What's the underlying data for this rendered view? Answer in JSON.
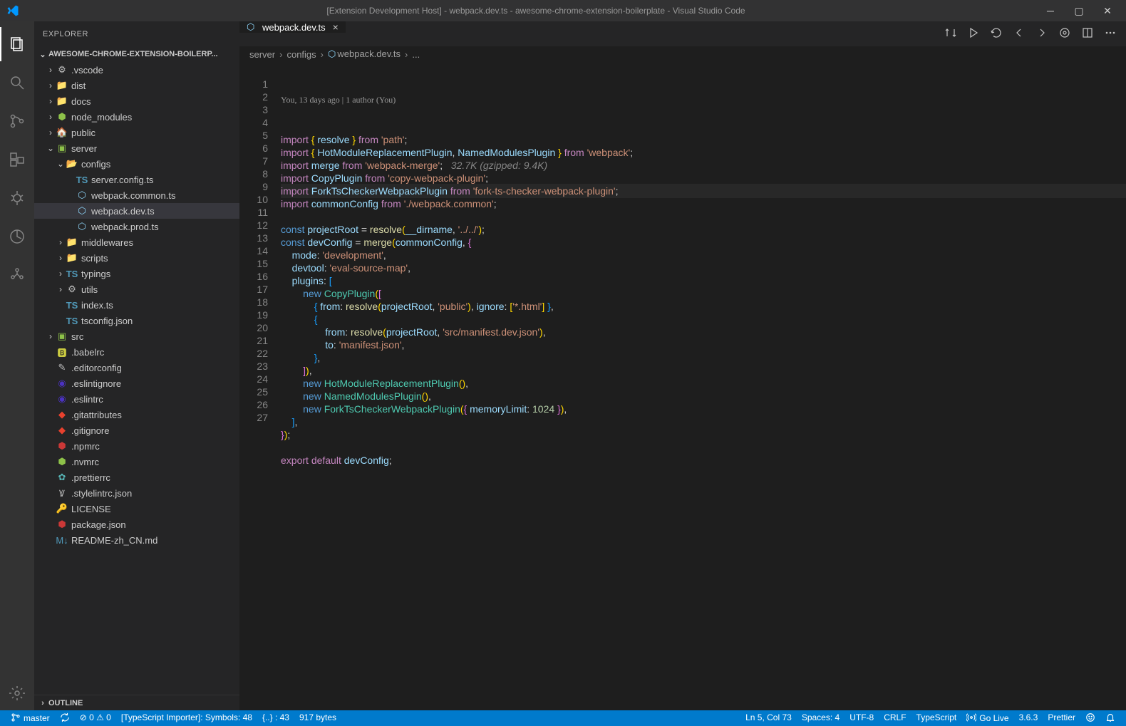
{
  "titlebar": {
    "title": "[Extension Development Host] - webpack.dev.ts - awesome-chrome-extension-boilerplate - Visual Studio Code"
  },
  "sidebar": {
    "panel_title": "EXPLORER",
    "workspace_header": "AWESOME-CHROME-EXTENSION-BOILERP...",
    "outline_header": "OUTLINE",
    "tree": [
      {
        "depth": 0,
        "kind": "folder",
        "expanded": false,
        "icon": "folder",
        "iconClass": "ic-gear",
        "glyph": "⚙",
        "label": ".vscode"
      },
      {
        "depth": 0,
        "kind": "folder",
        "expanded": false,
        "icon": "folder",
        "iconClass": "ic-folder",
        "glyph": "📁",
        "label": "dist"
      },
      {
        "depth": 0,
        "kind": "folder",
        "expanded": false,
        "icon": "folder",
        "iconClass": "ic-folder",
        "glyph": "📁",
        "label": "docs"
      },
      {
        "depth": 0,
        "kind": "folder",
        "expanded": false,
        "icon": "folder",
        "iconClass": "ic-node",
        "glyph": "⬢",
        "label": "node_modules"
      },
      {
        "depth": 0,
        "kind": "folder",
        "expanded": false,
        "icon": "folder",
        "iconClass": "ic-home",
        "glyph": "🏠",
        "label": "public"
      },
      {
        "depth": 0,
        "kind": "folder",
        "expanded": true,
        "icon": "folder",
        "iconClass": "ic-green",
        "glyph": "▣",
        "label": "server"
      },
      {
        "depth": 1,
        "kind": "folder",
        "expanded": true,
        "icon": "folder",
        "iconClass": "ic-folder",
        "glyph": "📂",
        "label": "configs"
      },
      {
        "depth": 2,
        "kind": "file",
        "icon": "ts",
        "iconClass": "ic-ts",
        "glyph": "TS",
        "label": "server.config.ts"
      },
      {
        "depth": 2,
        "kind": "file",
        "icon": "webpack",
        "iconClass": "ic-wp",
        "glyph": "⬡",
        "label": "webpack.common.ts"
      },
      {
        "depth": 2,
        "kind": "file",
        "icon": "webpack",
        "iconClass": "ic-wp",
        "glyph": "⬡",
        "label": "webpack.dev.ts",
        "selected": true
      },
      {
        "depth": 2,
        "kind": "file",
        "icon": "webpack",
        "iconClass": "ic-wp",
        "glyph": "⬡",
        "label": "webpack.prod.ts"
      },
      {
        "depth": 1,
        "kind": "folder",
        "expanded": false,
        "icon": "folder",
        "iconClass": "ic-folder",
        "glyph": "📁",
        "label": "middlewares"
      },
      {
        "depth": 1,
        "kind": "folder",
        "expanded": false,
        "icon": "folder",
        "iconClass": "ic-folder",
        "glyph": "📁",
        "label": "scripts"
      },
      {
        "depth": 1,
        "kind": "folder",
        "expanded": false,
        "icon": "folder",
        "iconClass": "ic-ts",
        "glyph": "TS",
        "label": "typings"
      },
      {
        "depth": 1,
        "kind": "folder",
        "expanded": false,
        "icon": "folder",
        "iconClass": "ic-gear",
        "glyph": "⚙",
        "label": "utils"
      },
      {
        "depth": 1,
        "kind": "file",
        "icon": "ts",
        "iconClass": "ic-ts",
        "glyph": "TS",
        "label": "index.ts"
      },
      {
        "depth": 1,
        "kind": "file",
        "icon": "ts",
        "iconClass": "ic-ts",
        "glyph": "TS",
        "label": "tsconfig.json"
      },
      {
        "depth": 0,
        "kind": "folder",
        "expanded": false,
        "icon": "folder",
        "iconClass": "ic-green",
        "glyph": "▣",
        "label": "src"
      },
      {
        "depth": 0,
        "kind": "file",
        "icon": "babel",
        "iconClass": "ic-js",
        "glyph": "🅱",
        "label": ".babelrc"
      },
      {
        "depth": 0,
        "kind": "file",
        "icon": "editorcfg",
        "iconClass": "ic-gear",
        "glyph": "✎",
        "label": ".editorconfig"
      },
      {
        "depth": 0,
        "kind": "file",
        "icon": "eslint",
        "iconClass": "ic-es",
        "glyph": "◉",
        "label": ".eslintignore"
      },
      {
        "depth": 0,
        "kind": "file",
        "icon": "eslint",
        "iconClass": "ic-es",
        "glyph": "◉",
        "label": ".eslintrc"
      },
      {
        "depth": 0,
        "kind": "file",
        "icon": "git",
        "iconClass": "ic-git",
        "glyph": "◆",
        "label": ".gitattributes"
      },
      {
        "depth": 0,
        "kind": "file",
        "icon": "git",
        "iconClass": "ic-git",
        "glyph": "◆",
        "label": ".gitignore"
      },
      {
        "depth": 0,
        "kind": "file",
        "icon": "npm",
        "iconClass": "ic-npm",
        "glyph": "⬢",
        "label": ".npmrc"
      },
      {
        "depth": 0,
        "kind": "file",
        "icon": "nvm",
        "iconClass": "ic-node",
        "glyph": "⬢",
        "label": ".nvmrc"
      },
      {
        "depth": 0,
        "kind": "file",
        "icon": "prettier",
        "iconClass": "ic-pret",
        "glyph": "✿",
        "label": ".prettierrc"
      },
      {
        "depth": 0,
        "kind": "file",
        "icon": "stylelint",
        "iconClass": "ic-gear",
        "glyph": "Ꝟ",
        "label": ".stylelintrc.json"
      },
      {
        "depth": 0,
        "kind": "file",
        "icon": "license",
        "iconClass": "ic-lic",
        "glyph": "🔑",
        "label": "LICENSE"
      },
      {
        "depth": 0,
        "kind": "file",
        "icon": "npm",
        "iconClass": "ic-npm",
        "glyph": "⬢",
        "label": "package.json"
      },
      {
        "depth": 0,
        "kind": "file",
        "icon": "md",
        "iconClass": "ic-md",
        "glyph": "M↓",
        "label": "README-zh_CN.md"
      }
    ]
  },
  "tabs": [
    {
      "icon": "⬡",
      "iconClass": "ic-wp",
      "label": "webpack.dev.ts",
      "active": true
    }
  ],
  "breadcrumbs": [
    {
      "label": "server"
    },
    {
      "label": "configs"
    },
    {
      "icon": "⬡",
      "label": "webpack.dev.ts"
    },
    {
      "label": "..."
    }
  ],
  "codelens": "You, 13 days ago | 1 author (You)",
  "code_lines": [
    "<span class='k-import'>import</span> <span class='k-brace'>{</span> <span class='k-var'>resolve</span> <span class='k-brace'>}</span> <span class='k-from'>from</span> <span class='k-str'>'path'</span>;",
    "<span class='k-import'>import</span> <span class='k-brace'>{</span> <span class='k-var'>HotModuleReplacementPlugin</span>, <span class='k-var'>NamedModulesPlugin</span> <span class='k-brace'>}</span> <span class='k-from'>from</span> <span class='k-str'>'webpack'</span>;",
    "<span class='k-import'>import</span> <span class='k-var'>merge</span> <span class='k-from'>from</span> <span class='k-str'>'webpack-merge'</span>;   <span class='k-hint'>32.7K (gzipped: 9.4K)</span>",
    "<span class='k-import'>import</span> <span class='k-var'>CopyPlugin</span> <span class='k-from'>from</span> <span class='k-str'>'copy-webpack-plugin'</span>;",
    "<span class='k-import'>import</span> <span class='k-var'>ForkTsCheckerWebpackPlugin</span> <span class='k-from'>from</span> <span class='k-str'>'fork-ts-checker-webpack-plugin'</span>;",
    "<span class='k-import'>import</span> <span class='k-var'>commonConfig</span> <span class='k-from'>from</span> <span class='k-str'>'./webpack.common'</span>;",
    "",
    "<span class='k-const'>const</span> <span class='k-var'>projectRoot</span> = <span class='k-fn'>resolve</span><span class='k-brace'>(</span><span class='k-var'>__dirname</span>, <span class='k-str'>'../../'</span><span class='k-brace'>)</span>;",
    "<span class='k-const'>const</span> <span class='k-var'>devConfig</span> = <span class='k-fn'>merge</span><span class='k-brace'>(</span><span class='k-var'>commonConfig</span>, <span class='k-brace2'>{</span>",
    "    <span class='k-prop'>mode</span>: <span class='k-str'>'development'</span>,",
    "    <span class='k-prop'>devtool</span>: <span class='k-str'>'eval-source-map'</span>,",
    "    <span class='k-prop'>plugins</span>: <span class='k-brace3'>[</span>",
    "        <span class='k-new'>new</span> <span class='k-type'>CopyPlugin</span><span class='k-brace'>(</span><span class='k-brace2'>[</span>",
    "            <span class='k-brace3'>{</span> <span class='k-prop'>from</span>: <span class='k-fn'>resolve</span><span class='k-brace'>(</span><span class='k-var'>projectRoot</span>, <span class='k-str'>'public'</span><span class='k-brace'>)</span>, <span class='k-prop'>ignore</span>: <span class='k-brace'>[</span><span class='k-str'>'*.html'</span><span class='k-brace'>]</span> <span class='k-brace3'>}</span>,",
    "            <span class='k-brace3'>{</span>",
    "                <span class='k-prop'>from</span>: <span class='k-fn'>resolve</span><span class='k-brace'>(</span><span class='k-var'>projectRoot</span>, <span class='k-str'>'src/manifest.dev.json'</span><span class='k-brace'>)</span>,",
    "                <span class='k-prop'>to</span>: <span class='k-str'>'manifest.json'</span>,",
    "            <span class='k-brace3'>}</span>,",
    "        <span class='k-brace2'>]</span><span class='k-brace'>)</span>,",
    "        <span class='k-new'>new</span> <span class='k-type'>HotModuleReplacementPlugin</span><span class='k-brace'>(</span><span class='k-brace'>)</span>,",
    "        <span class='k-new'>new</span> <span class='k-type'>NamedModulesPlugin</span><span class='k-brace'>(</span><span class='k-brace'>)</span>,",
    "        <span class='k-new'>new</span> <span class='k-type'>ForkTsCheckerWebpackPlugin</span><span class='k-brace'>(</span><span class='k-brace2'>{</span> <span class='k-prop'>memoryLimit</span>: <span class='k-num'>1024</span> <span class='k-brace2'>}</span><span class='k-brace'>)</span>,",
    "    <span class='k-brace3'>]</span>,",
    "<span class='k-brace2'>}</span><span class='k-brace'>)</span>;",
    "",
    "<span class='k-kw'>export</span> <span class='k-kw'>default</span> <span class='k-var'>devConfig</span>;",
    ""
  ],
  "highlight_line": 5,
  "statusbar": {
    "left": [
      {
        "icon": "branch",
        "label": "master"
      },
      {
        "icon": "sync",
        "label": ""
      },
      {
        "icon": "errwarn",
        "label": "⊘ 0 ⚠ 0"
      },
      {
        "label": "[TypeScript Importer]: Symbols: 48"
      },
      {
        "label": "{..} : 43"
      },
      {
        "label": "917 bytes"
      }
    ],
    "right": [
      {
        "label": "Ln 5, Col 73"
      },
      {
        "label": "Spaces: 4"
      },
      {
        "label": "UTF-8"
      },
      {
        "label": "CRLF"
      },
      {
        "label": "TypeScript"
      },
      {
        "icon": "antenna",
        "label": "Go Live"
      },
      {
        "label": "3.6.3"
      },
      {
        "label": "Prettier"
      },
      {
        "icon": "smile",
        "label": ""
      },
      {
        "icon": "bell",
        "label": ""
      }
    ]
  }
}
